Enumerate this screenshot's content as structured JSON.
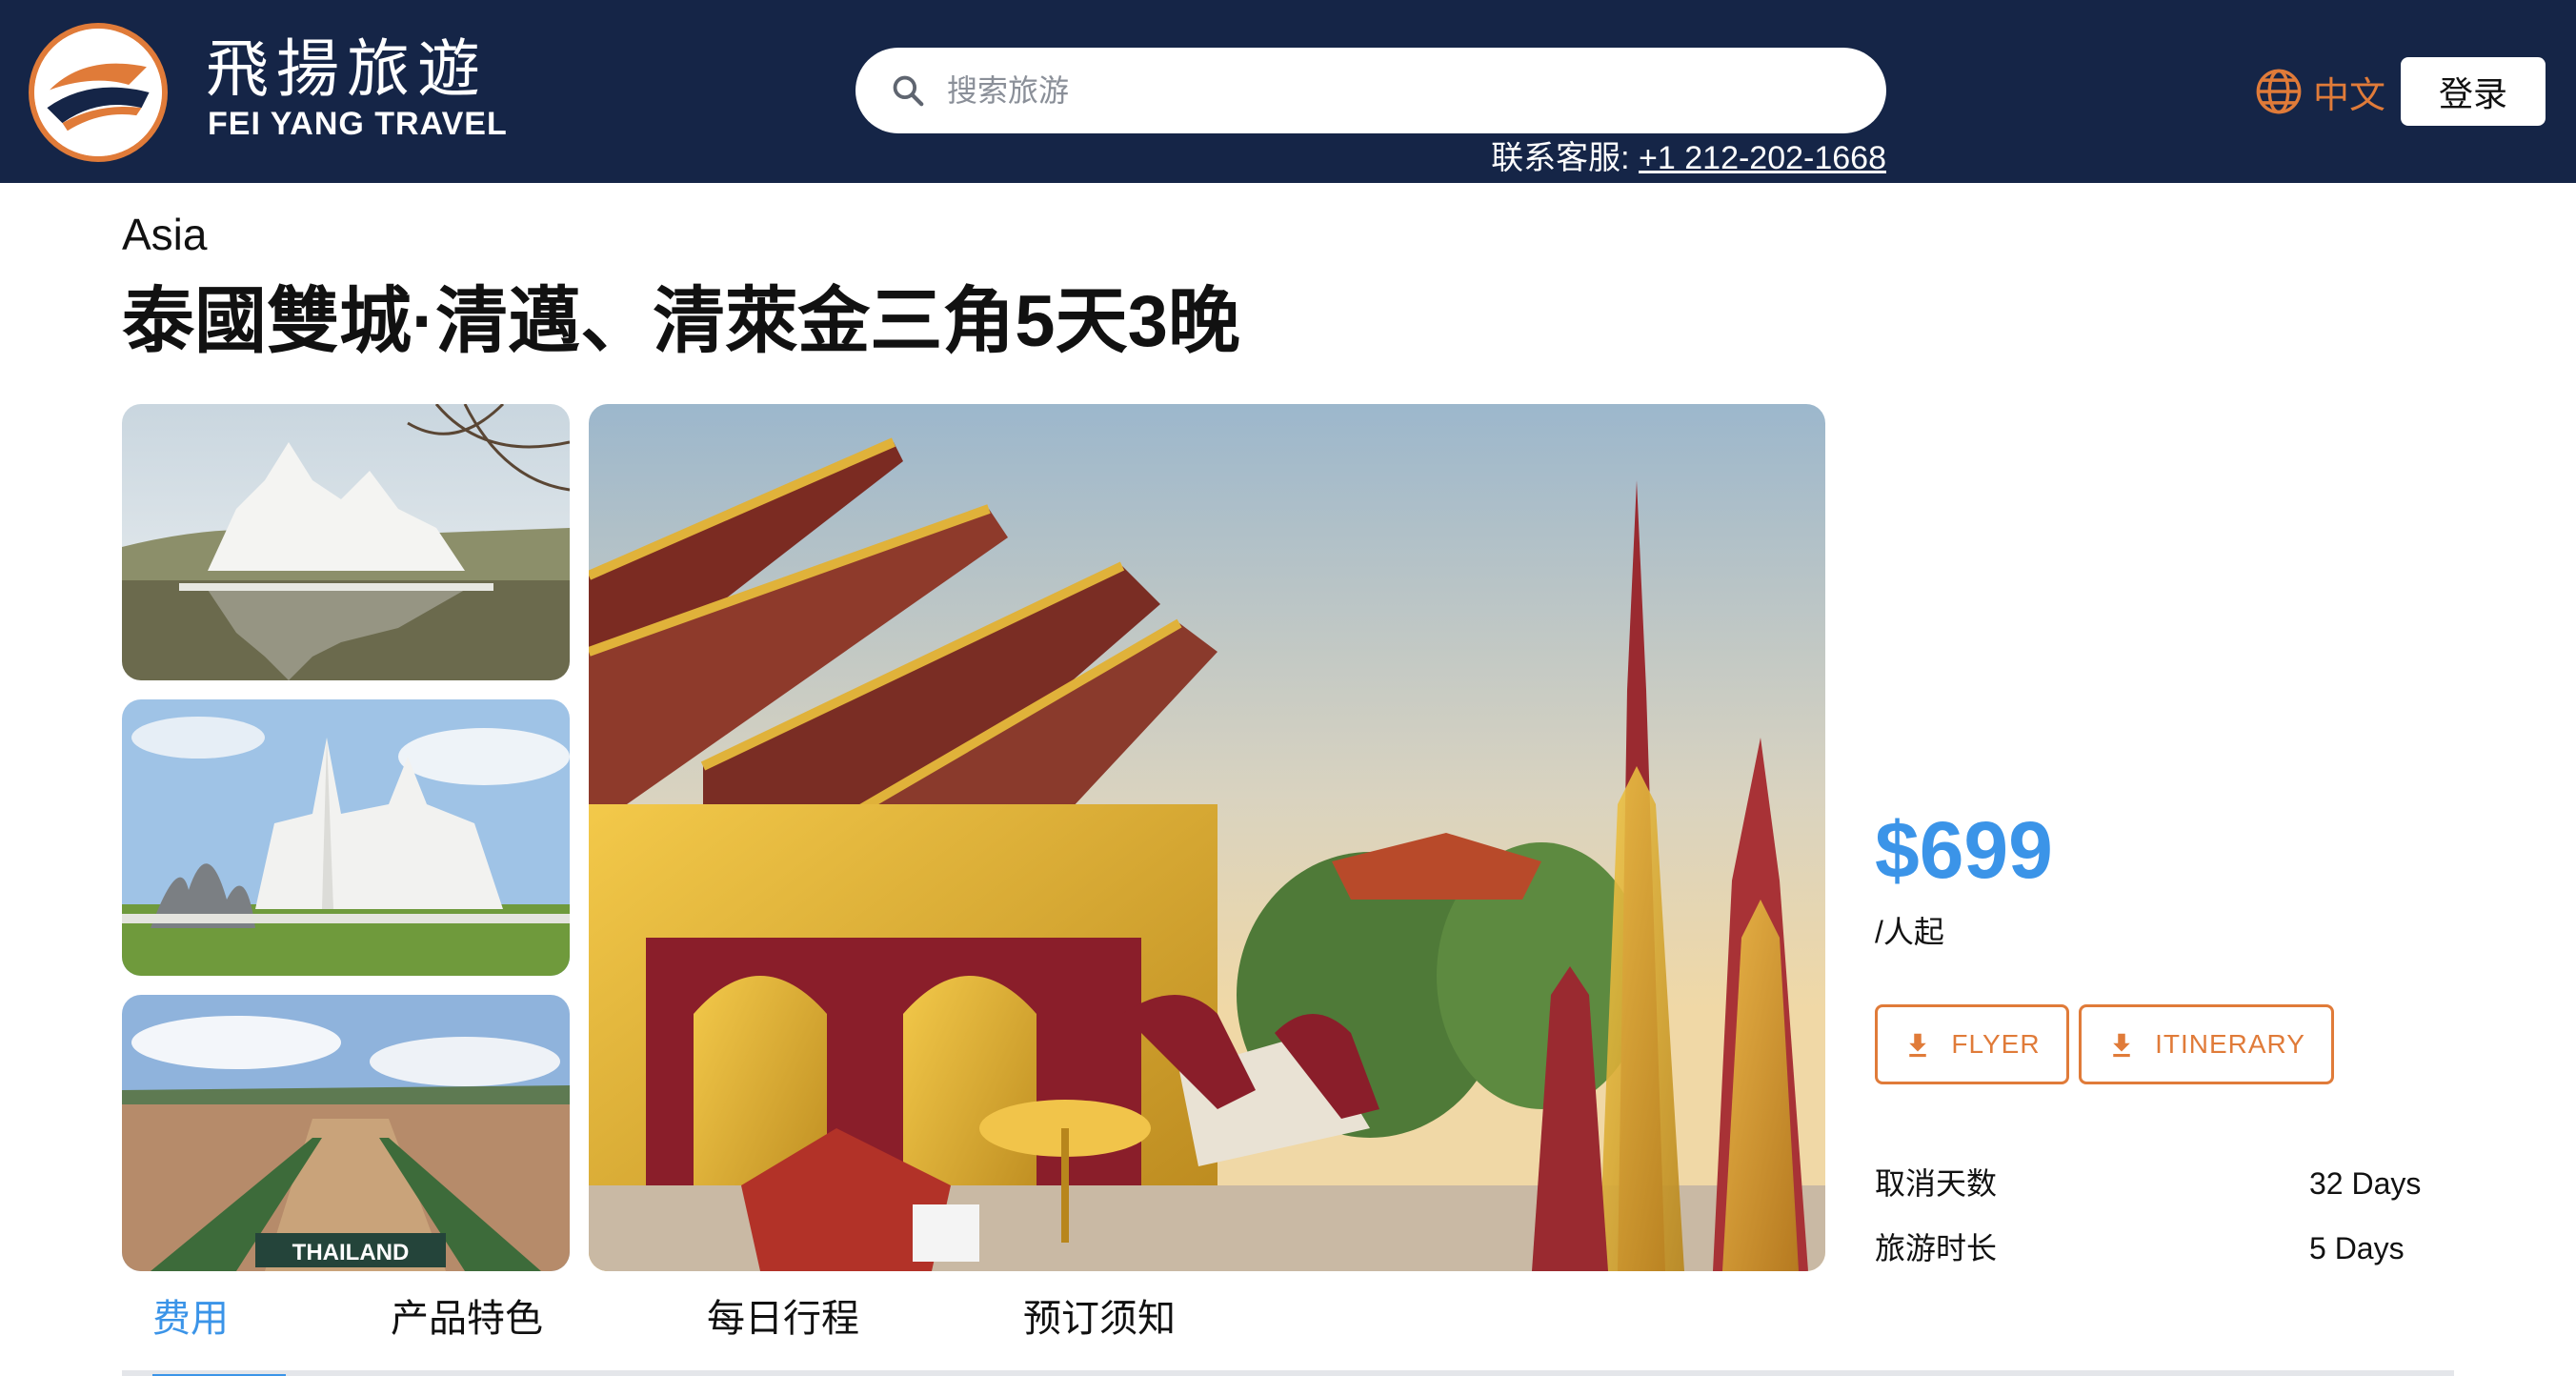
{
  "header": {
    "logo_cn": "飛揚旅遊",
    "logo_en": "FEI YANG TRAVEL",
    "search_placeholder": "搜索旅游",
    "hotline_label": "联系客服: ",
    "hotline_number": "+1 212-202-1668",
    "language_label": "中文",
    "login_label": "登录"
  },
  "product": {
    "region": "Asia",
    "title": "泰國雙城·清邁、清萊金三角5天3晚",
    "price": "$699",
    "price_unit": "/人起",
    "flyer_label": "FLYER",
    "itinerary_label": "ITINERARY",
    "info": [
      {
        "label": "取消天数",
        "value": "32 Days"
      },
      {
        "label": "旅游时长",
        "value": "5 Days"
      }
    ],
    "photo_caption": "THAILAND"
  },
  "tabs": [
    {
      "label": "费用",
      "active": true
    },
    {
      "label": "产品特色",
      "active": false
    },
    {
      "label": "每日行程",
      "active": false
    },
    {
      "label": "预订须知",
      "active": false
    }
  ],
  "colors": {
    "header_bg": "#152547",
    "accent_orange": "#e07b39",
    "price_blue": "#3b94e8"
  },
  "icons": {
    "search": "search-icon",
    "language": "globe-icon",
    "download": "download-icon"
  }
}
